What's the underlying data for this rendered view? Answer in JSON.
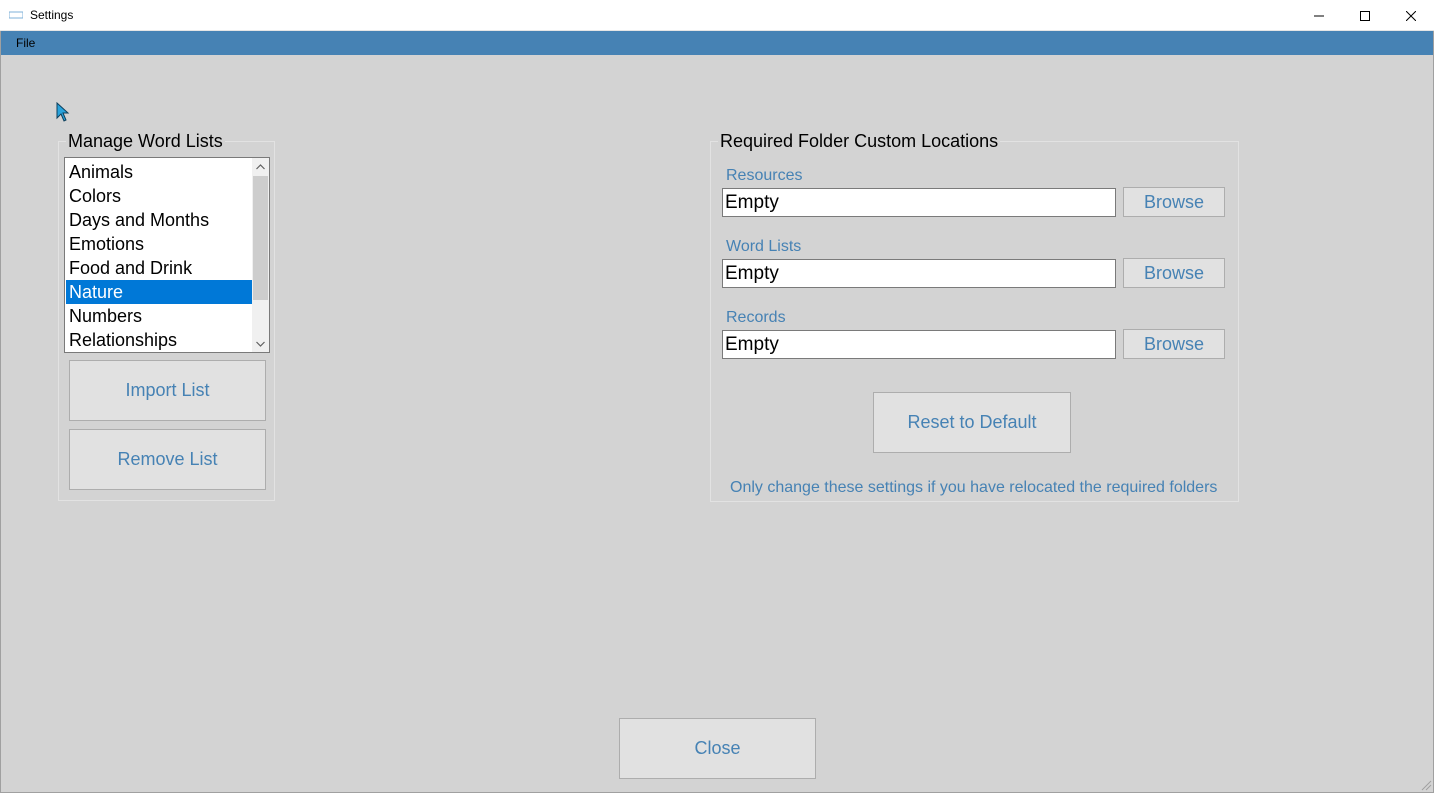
{
  "window": {
    "title": "Settings",
    "controls": {
      "minimize": "minimize-icon",
      "maximize": "maximize-icon",
      "close": "close-icon"
    }
  },
  "menu": {
    "file": "File"
  },
  "word_lists": {
    "title": "Manage Word Lists",
    "items": [
      "Animals",
      "Colors",
      "Days and Months",
      "Emotions",
      "Food and Drink",
      "Nature",
      "Numbers",
      "Relationships"
    ],
    "selected": "Nature",
    "import_button": "Import List",
    "remove_button": "Remove List"
  },
  "folders": {
    "title": "Required Folder Custom Locations",
    "resources_label": "Resources",
    "resources_value": "Empty",
    "word_lists_label": "Word Lists",
    "word_lists_value": "Empty",
    "records_label": "Records",
    "records_value": "Empty",
    "browse_label": "Browse",
    "reset_button": "Reset to Default",
    "note": "Only change these settings if you have relocated the required folders"
  },
  "close_button": "Close",
  "colors": {
    "background": "#d3d3d3",
    "menu_bar": "#4682b4",
    "accent_text": "#4682b4",
    "selection": "#0078d7"
  }
}
